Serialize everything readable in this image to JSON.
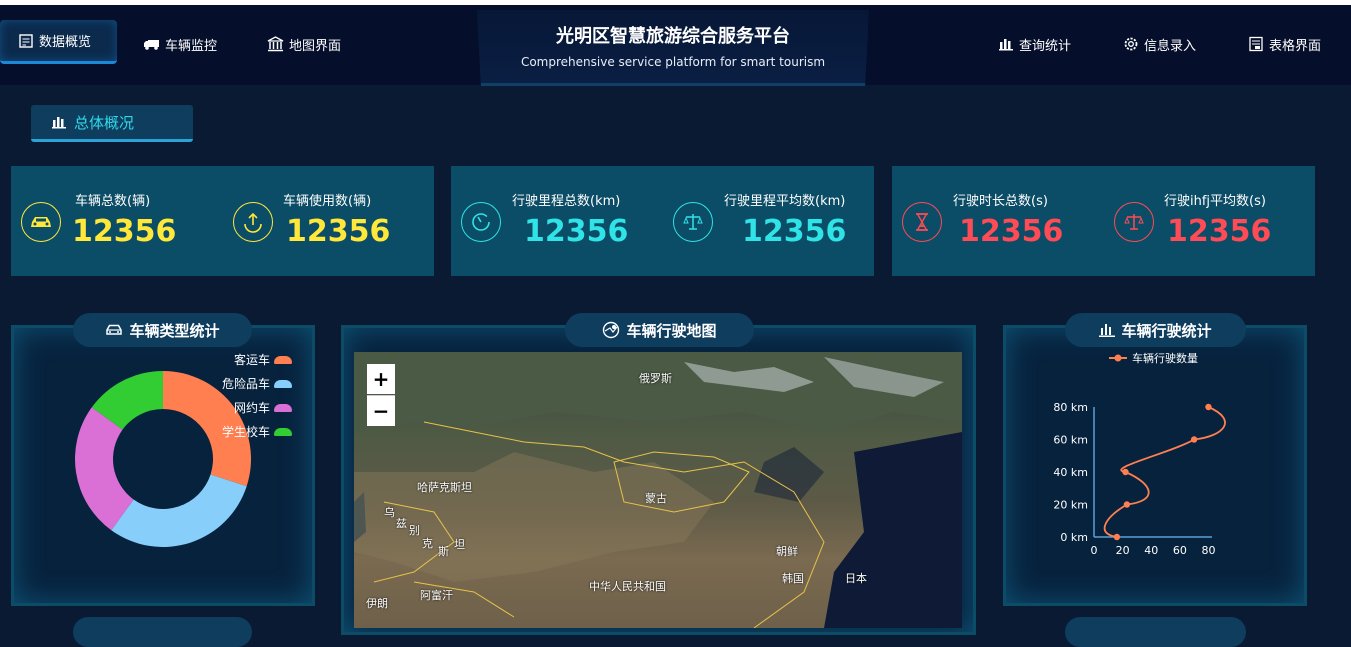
{
  "header": {
    "title": "光明区智慧旅游综合服务平台",
    "subtitle": "Comprehensive service platform for smart tourism",
    "nav_left": [
      {
        "label": "数据概览",
        "icon": "document-icon"
      },
      {
        "label": "车辆监控",
        "icon": "truck-icon"
      },
      {
        "label": "地图界面",
        "icon": "bank-icon"
      }
    ],
    "nav_right": [
      {
        "label": "查询统计",
        "icon": "bar-chart-icon"
      },
      {
        "label": "信息录入",
        "icon": "gear-icon"
      },
      {
        "label": "表格界面",
        "icon": "table-icon"
      }
    ]
  },
  "section": {
    "label": "总体概况"
  },
  "stats": [
    {
      "label": "车辆总数(辆)",
      "value": "12356",
      "color": "#ffe83a",
      "icon": "car-icon"
    },
    {
      "label": "车辆使用数(辆)",
      "value": "12356",
      "color": "#ffe83a",
      "icon": "upload-icon"
    },
    {
      "label": "行驶里程总数(km)",
      "value": "12356",
      "color": "#2fe3e6",
      "icon": "gauge-icon"
    },
    {
      "label": "行驶里程平均数(km)",
      "value": "12356",
      "color": "#2fe3e6",
      "icon": "scale-icon"
    },
    {
      "label": "行驶时长总数(s)",
      "value": "12356",
      "color": "#ff4b55",
      "icon": "hourglass-icon"
    },
    {
      "label": "行驶ihfj平均数(s)",
      "value": "12356",
      "color": "#ff4b55",
      "icon": "scale-icon"
    }
  ],
  "panels": {
    "vehicle_types": {
      "title": "车辆类型统计"
    },
    "map": {
      "title": "车辆行驶地图",
      "zoom_in": "+",
      "zoom_out": "−",
      "labels": [
        "俄罗斯",
        "哈萨克斯坦",
        "蒙古",
        "中华人民共和国",
        "朝鲜",
        "韩国",
        "日本",
        "阿富汗",
        "伊朗",
        "乌",
        "兹",
        "别",
        "克",
        "斯",
        "坦"
      ]
    },
    "driving": {
      "title": "车辆行驶统计"
    }
  },
  "chart_data": [
    {
      "type": "pie",
      "categories": [
        "客运车",
        "危险品车",
        "网约车",
        "学生校车"
      ],
      "values": [
        30,
        30,
        25,
        15
      ],
      "colors": [
        "#ff7f50",
        "#87cefa",
        "#da70d6",
        "#32cd32"
      ],
      "donut": true
    },
    {
      "type": "line",
      "series": [
        {
          "name": "车辆行驶数量",
          "color": "#ff7f50",
          "points": [
            [
              16,
              0
            ],
            [
              23,
              20
            ],
            [
              22,
              40
            ],
            [
              70,
              60
            ],
            [
              80,
              80
            ]
          ]
        }
      ],
      "xticks": [
        "0",
        "20",
        "40",
        "60",
        "80"
      ],
      "yticks": [
        "0 km",
        "20 km",
        "40 km",
        "60 km",
        "80 km"
      ],
      "xlim": [
        0,
        80
      ],
      "ylim": [
        0,
        80
      ],
      "smooth": true
    }
  ]
}
